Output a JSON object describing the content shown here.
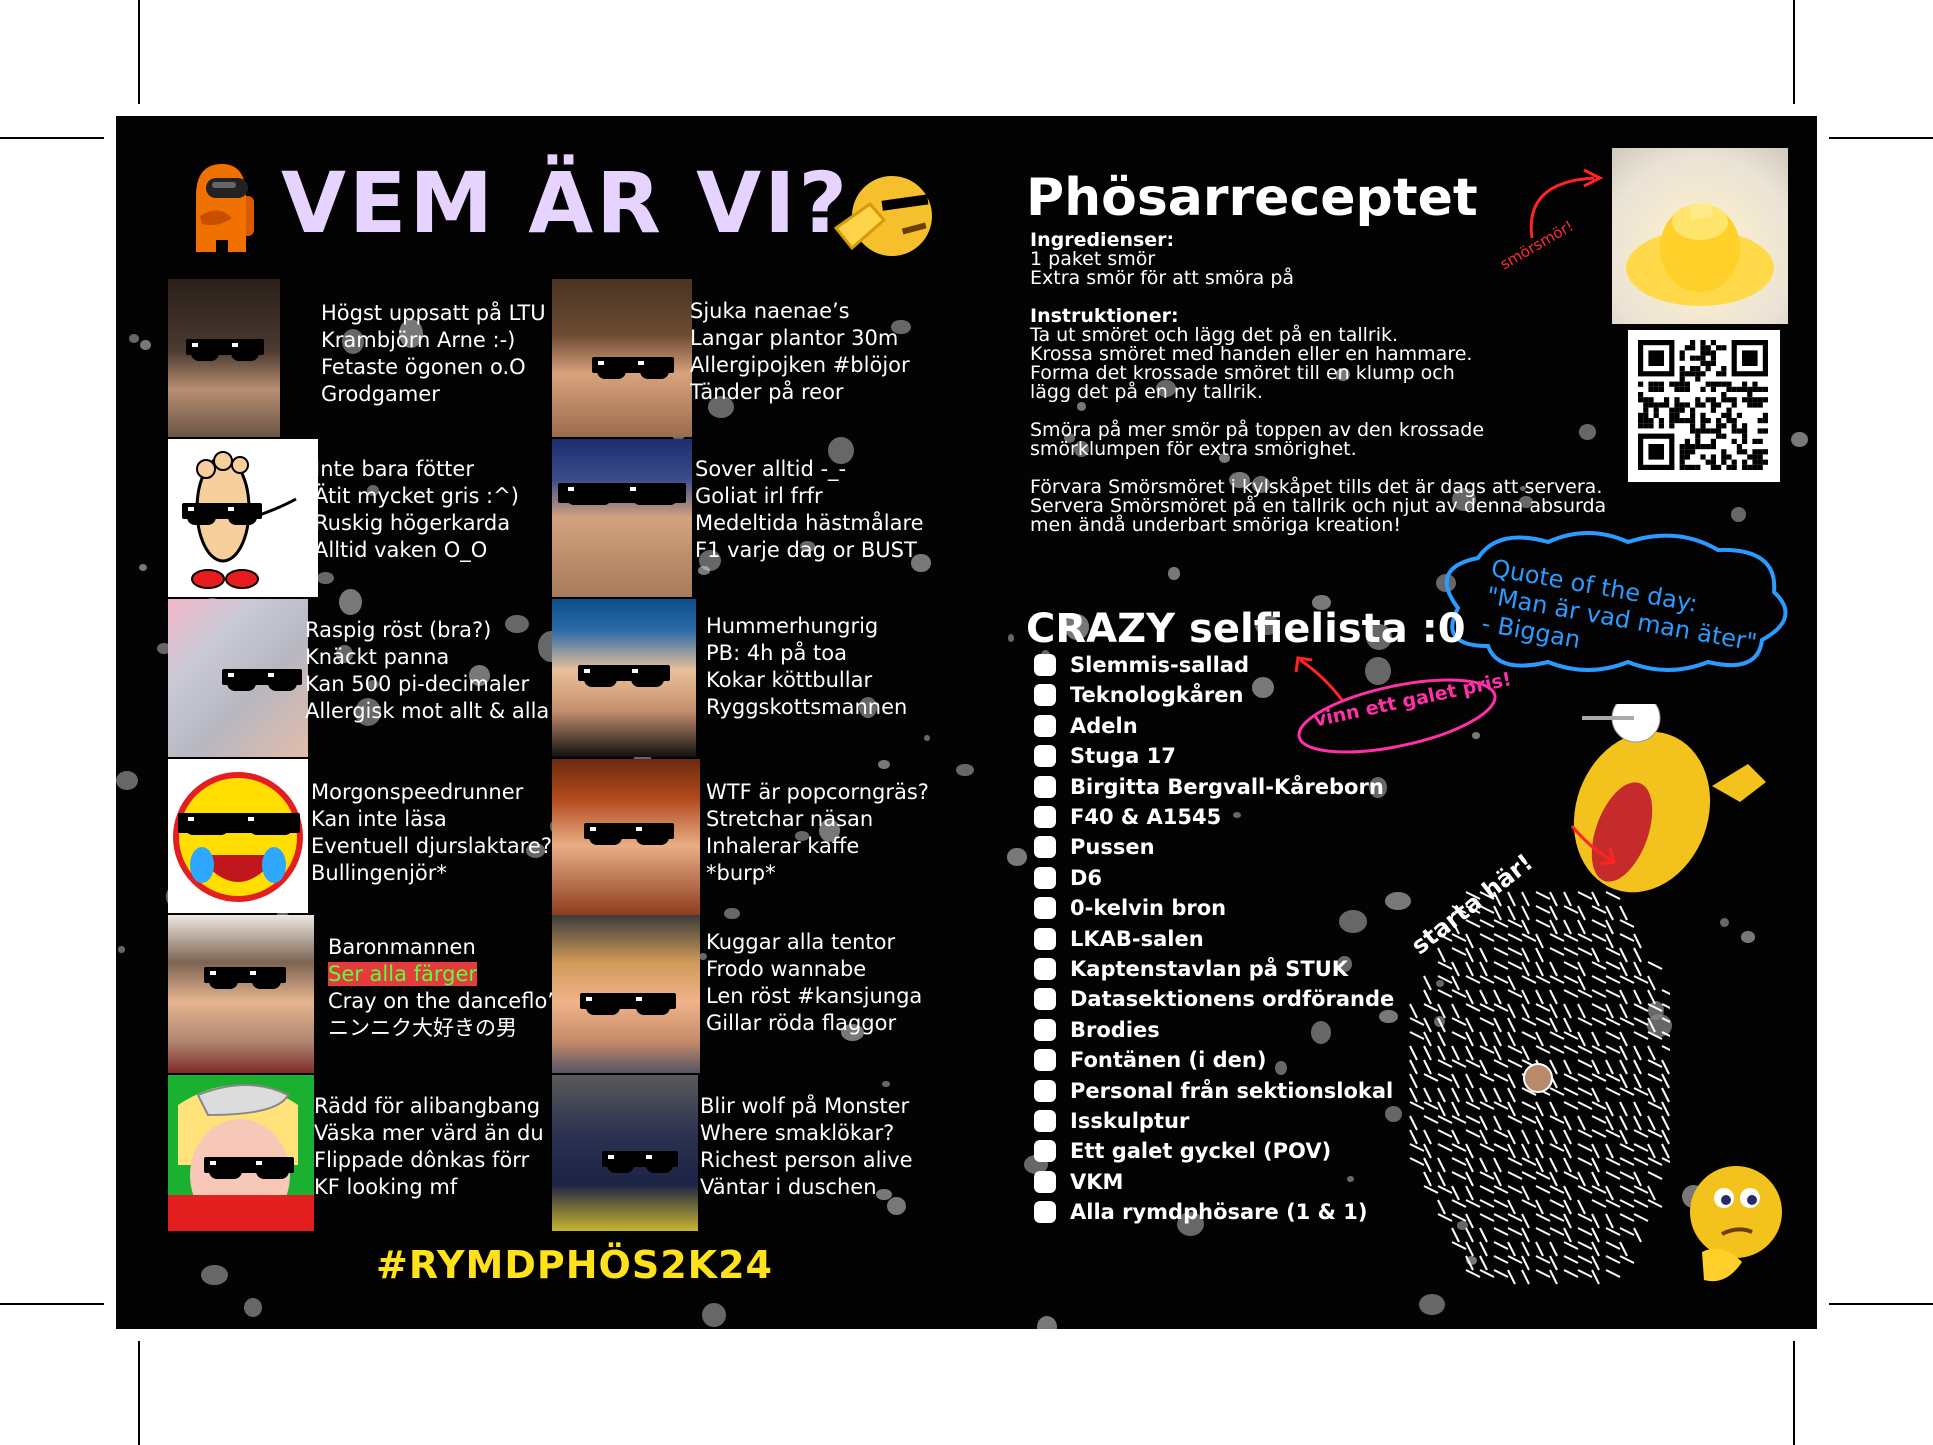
{
  "left": {
    "title": "VEM ÄR VI?",
    "hashtag": "#RYMDPHÖS2K24",
    "people": [
      {
        "lines": [
          "Högst uppsatt på LTU",
          "Krambjörn Arne :-)",
          "Fetaste ögonen o.O",
          "Grodgamer"
        ]
      },
      {
        "lines": [
          "Inte bara fötter",
          "Ätit mycket gris :^)",
          "Ruskig högerkarda",
          "Alltid vaken O_O"
        ]
      },
      {
        "lines": [
          "Raspig röst (bra?)",
          "Knäckt panna",
          "Kan 500 pi-decimaler",
          "Allergisk mot allt & alla"
        ]
      },
      {
        "lines": [
          "Morgonspeedrunner",
          "Kan inte läsa",
          "Eventuell djurslaktare?",
          "Bullingenjör*"
        ]
      },
      {
        "lines": [
          "Baronmannen",
          "Ser alla färger",
          "Cray on the danceflo’",
          "ニンニク大好きの男"
        ]
      },
      {
        "lines": [
          "Rädd för alibangbang",
          "Väska mer värd än du",
          "Flippade dônkas förr",
          "KF looking mf"
        ]
      },
      {
        "lines": [
          "Sjuka naenae’s",
          "Langar plantor 30m",
          "Allergipojken #blöjor",
          "Tänder på reor"
        ]
      },
      {
        "lines": [
          "Sover alltid -_-",
          "Goliat irl frfr",
          "Medeltida hästmålare",
          "F1 varje dag or BUST"
        ]
      },
      {
        "lines": [
          "Hummerhungrig",
          "PB: 4h på toa",
          "Kokar köttbullar",
          "Ryggskottsmannen"
        ]
      },
      {
        "lines": [
          "WTF är popcorngräs?",
          "Stretchar näsan",
          "Inhalerar kaffe",
          "*burp*"
        ]
      },
      {
        "lines": [
          "Kuggar alla tentor",
          "Frodo wannabe",
          "Len röst #kansjunga",
          "Gillar röda flaggor"
        ]
      },
      {
        "lines": [
          "Blir wolf på Monster",
          "Where smaklökar?",
          "Richest person alive",
          "Väntar i duschen"
        ]
      }
    ]
  },
  "right": {
    "recipe_title": "Phösarreceptet",
    "recipe_lines": [
      {
        "t": "Ingredienser:",
        "bold": true
      },
      {
        "t": "1 paket smör",
        "bold": false
      },
      {
        "t": "Extra smör för att smöra på",
        "bold": false
      },
      {
        "t": "",
        "bold": false
      },
      {
        "t": "Instruktioner:",
        "bold": true
      },
      {
        "t": "Ta ut smöret  och lägg det på en tallrik.",
        "bold": false
      },
      {
        "t": "Krossa smöret med handen eller en hammare.",
        "bold": false
      },
      {
        "t": "Forma det krossade smöret till en klump och",
        "bold": false
      },
      {
        "t": "lägg det på en ny tallrik.",
        "bold": false
      },
      {
        "t": "",
        "bold": false
      },
      {
        "t": "Smöra på mer smör på toppen av den krossade",
        "bold": false
      },
      {
        "t": "smörklumpen för extra smörighet.",
        "bold": false
      },
      {
        "t": "",
        "bold": false
      },
      {
        "t": "Förvara Smörsmöret i kylskåpet tills det är dags att servera.",
        "bold": false
      },
      {
        "t": "Servera Smörsmöret på en tallrik och njut av denna absurda",
        "bold": false
      },
      {
        "t": "men ändå underbart smöriga kreation!",
        "bold": false
      }
    ],
    "butter_label": "smörsmör!",
    "quote": [
      "Quote of the day:",
      "\"Man är vad man äter\"",
      "- Biggan"
    ],
    "list_title": "CRAZY selfielista :0",
    "prize": "vinn ett galet pris!",
    "maze_label": "starta här!",
    "selfie_items": [
      "Slemmis-sallad",
      "Teknologkåren",
      "Adeln",
      "Stuga 17",
      "Birgitta Bergvall-Kåreborn",
      "F40 & A1545",
      "Pussen",
      "D6",
      "0-kelvin bron",
      "LKAB-salen",
      "Kaptenstavlan på STUK",
      "Datasektionens ordförande",
      "Brodies",
      "Fontänen (i den)",
      "Personal från sektionslokal",
      "Isskulptur",
      "Ett galet gyckel (POV)",
      "VKM",
      "Alla rymdphösare (1 & 1)"
    ]
  },
  "colors": {
    "title": "#e7d3ff",
    "hashtag": "#ffe21a",
    "accent_pink": "#ff2fa8",
    "accent_blue": "#2b9bff",
    "arrow_red": "#ff2424"
  }
}
